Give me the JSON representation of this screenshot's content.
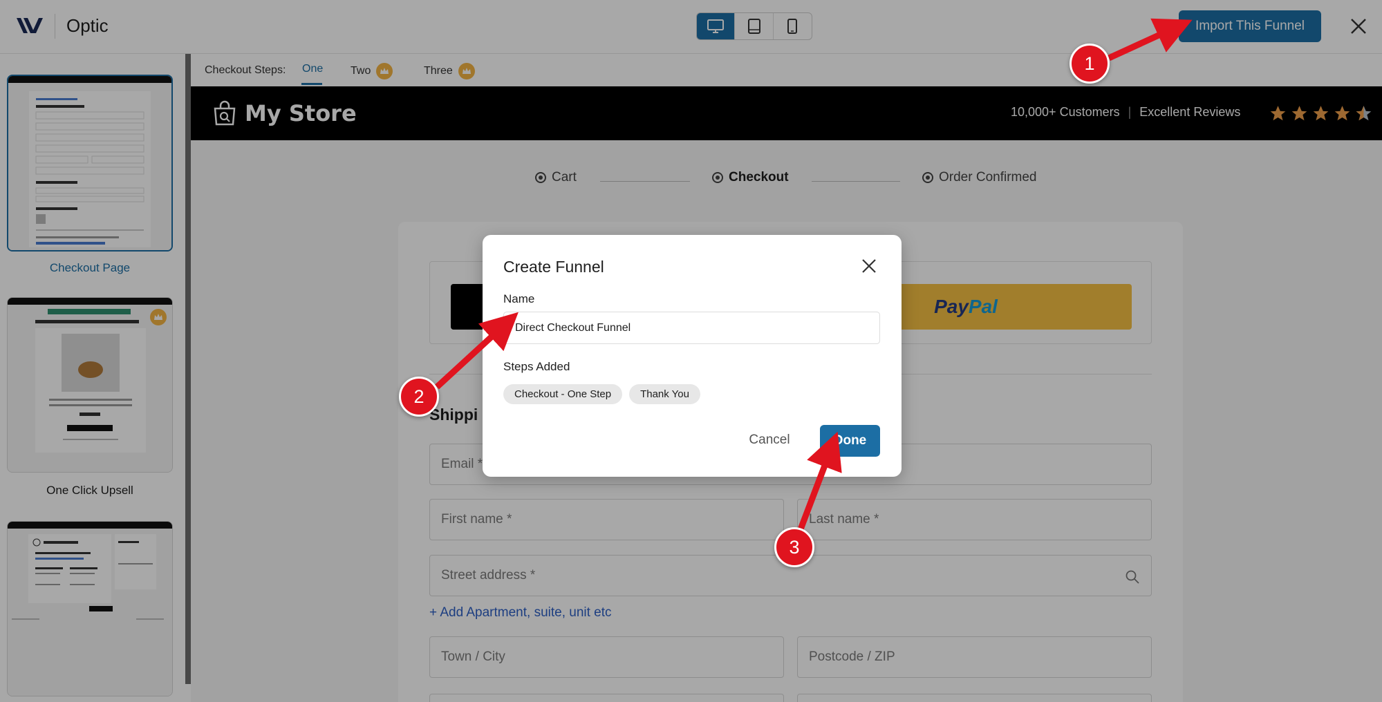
{
  "app": {
    "title": "Optic"
  },
  "topbar": {
    "devices": [
      "desktop-icon",
      "tablet-icon",
      "mobile-icon"
    ],
    "active_device": "desktop",
    "import_label": "Import This Funnel"
  },
  "sidebar": {
    "pages": [
      {
        "label": "Checkout Page",
        "active": true
      },
      {
        "label": "One Click Upsell",
        "active": false
      },
      {
        "label": "",
        "active": false
      }
    ]
  },
  "preview": {
    "steps_label": "Checkout Steps:",
    "steps": [
      {
        "label": "One",
        "active": true,
        "premium": false
      },
      {
        "label": "Two",
        "active": false,
        "premium": true
      },
      {
        "label": "Three",
        "active": false,
        "premium": true
      }
    ],
    "store": {
      "name": "My Store",
      "customers": "10,000+ Customers",
      "reviews": "Excellent Reviews",
      "rating": 4.5
    },
    "progress": [
      {
        "label": "Cart",
        "active": false
      },
      {
        "label": "Checkout",
        "active": true
      },
      {
        "label": "Order Confirmed",
        "active": false
      }
    ],
    "form": {
      "paypal_pay": "Pay",
      "paypal_pal": "Pal",
      "shipping_title": "Shippi",
      "email": "Email *",
      "first_name": "First name *",
      "last_name": "Last name *",
      "street": "Street address *",
      "add_apartment": "+ Add Apartment, suite, unit etc",
      "town": "Town / City",
      "postcode": "Postcode / ZIP"
    }
  },
  "modal": {
    "title": "Create Funnel",
    "name_label": "Name",
    "name_value": "Direct Checkout Funnel",
    "steps_added_label": "Steps Added",
    "steps": [
      "Checkout - One Step",
      "Thank You"
    ],
    "cancel_label": "Cancel",
    "done_label": "Done"
  },
  "annotations": [
    {
      "number": "1"
    },
    {
      "number": "2"
    },
    {
      "number": "3"
    }
  ],
  "colors": {
    "accent": "#1c6ea4",
    "marker": "#e0141f",
    "crown": "#f3b443",
    "star": "#f0a04b",
    "paypal": "#f5c044"
  }
}
